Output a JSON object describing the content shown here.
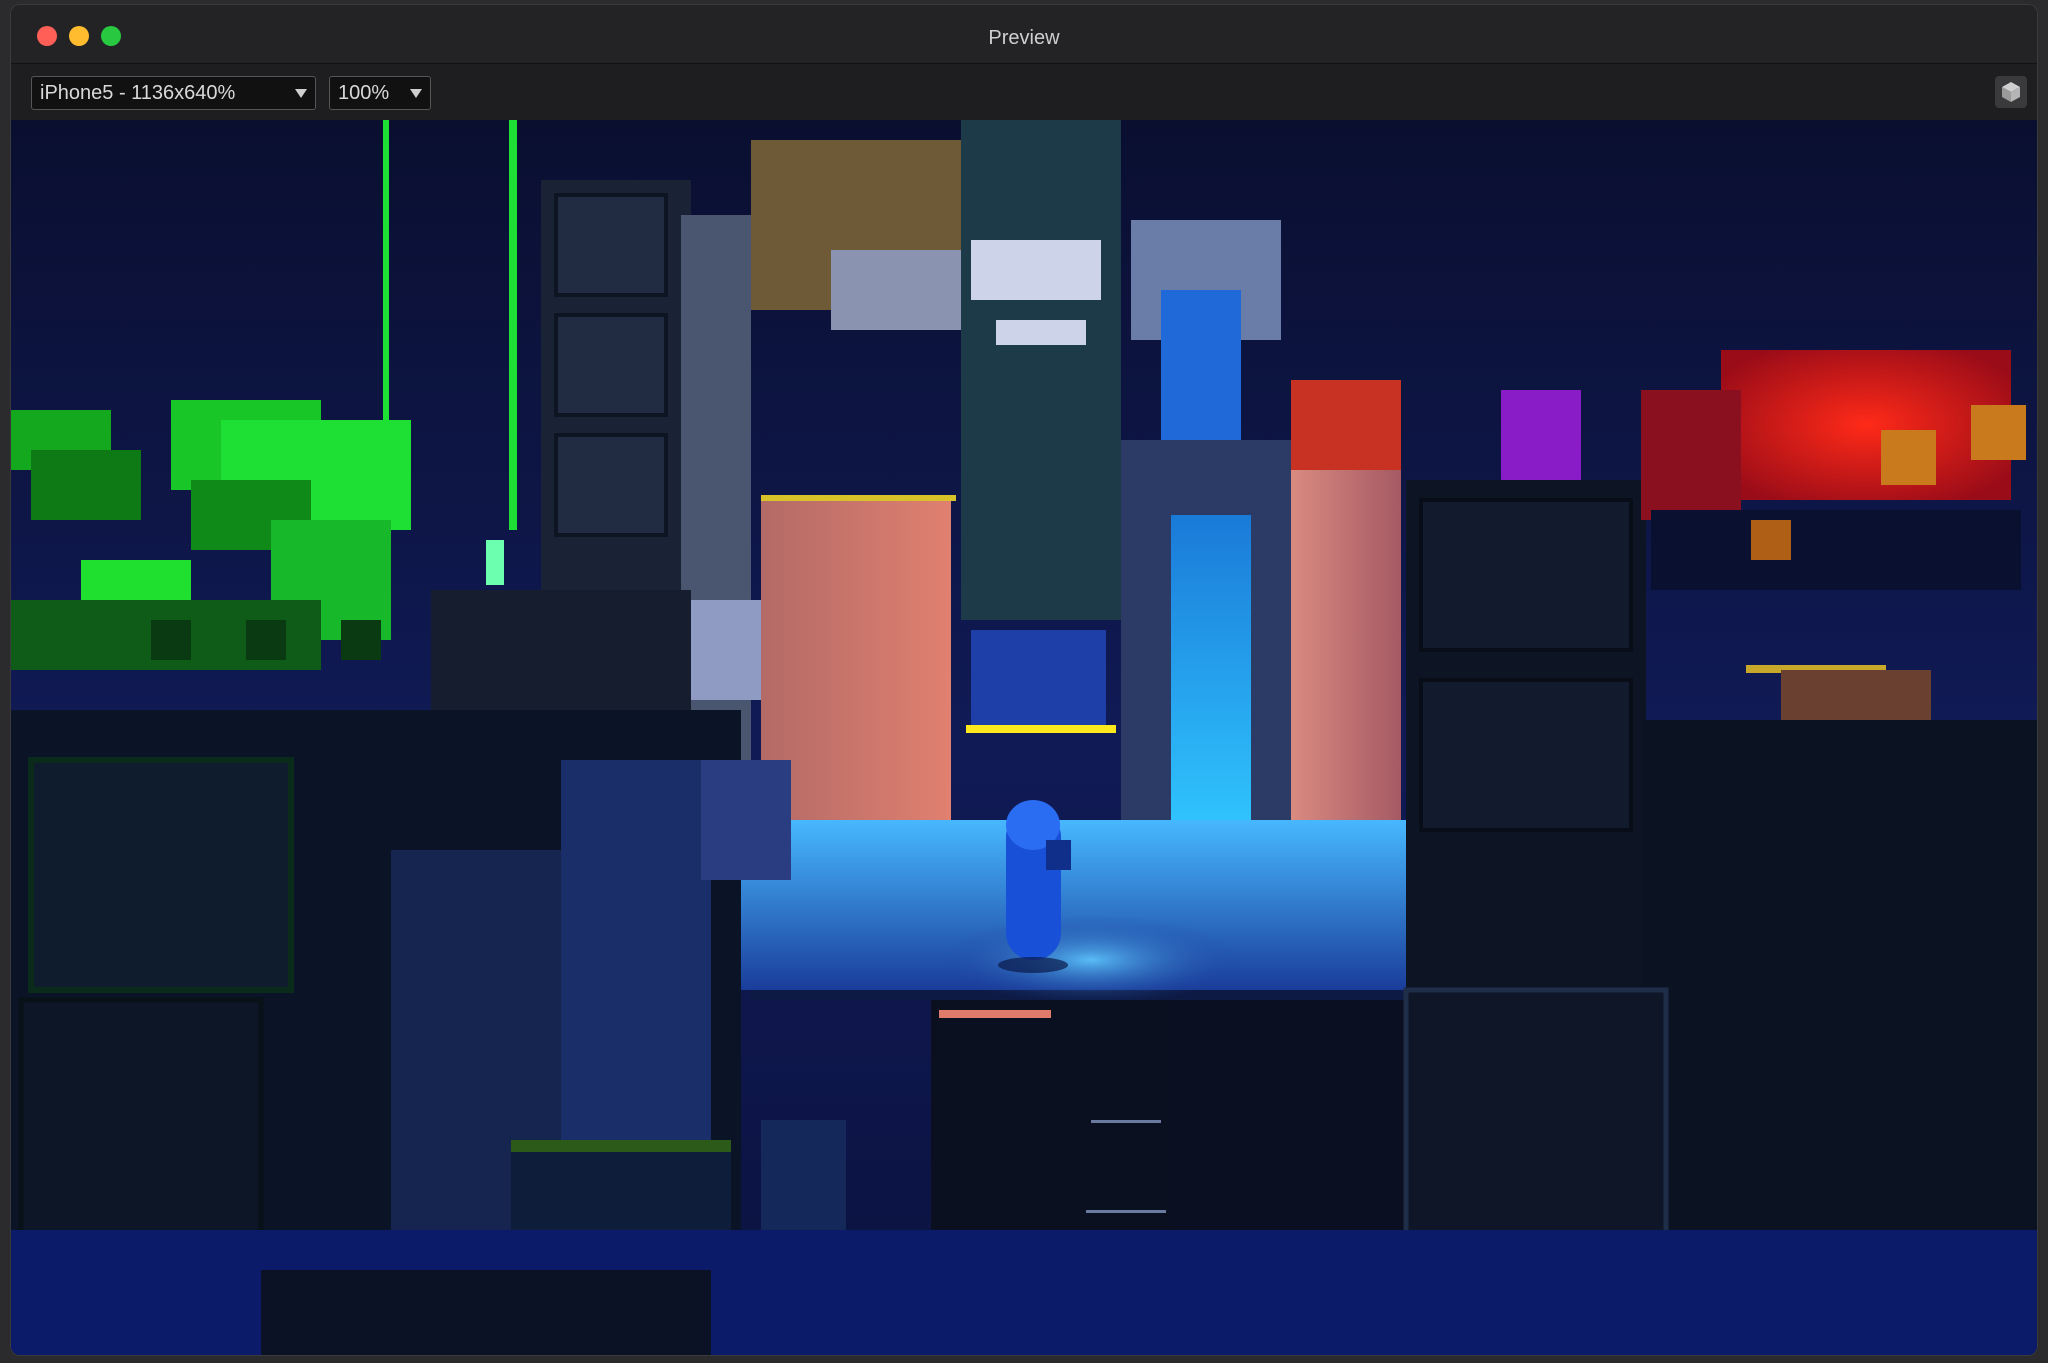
{
  "window": {
    "title": "Preview"
  },
  "toolbar": {
    "device_select": {
      "value": "iPhone5 - 1136x640%",
      "icon": "chevron-down-icon"
    },
    "zoom_select": {
      "value": "100%",
      "icon": "chevron-down-icon"
    },
    "scene_button": {
      "icon": "cube-icon"
    }
  },
  "viewport": {
    "description_icon": "game-scene",
    "colors": {
      "sky": "#0c1033",
      "green": "#19e02c",
      "red": "#ff1c10",
      "coral": "#e0786a",
      "cyan": "#1fb6ff",
      "purple": "#8a1cc7",
      "player": "#1850d8"
    }
  }
}
